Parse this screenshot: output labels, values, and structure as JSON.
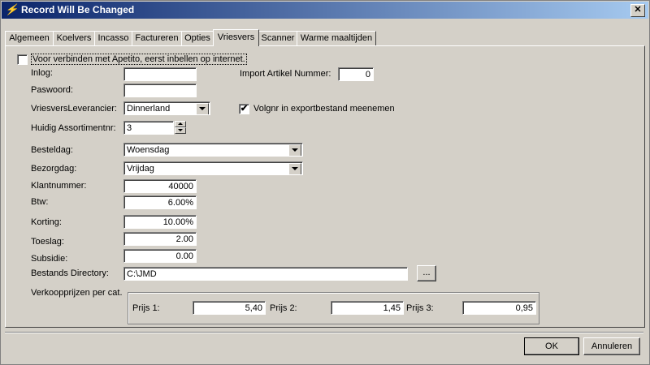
{
  "window": {
    "title": "Record Will Be Changed"
  },
  "tabs": [
    {
      "label": "Algemeen"
    },
    {
      "label": "Koelvers"
    },
    {
      "label": "Incasso"
    },
    {
      "label": "Factureren"
    },
    {
      "label": "Opties"
    },
    {
      "label": "Vriesvers",
      "active": true
    },
    {
      "label": "Scanner"
    },
    {
      "label": "Warme maaltijden"
    }
  ],
  "form": {
    "apetito_checkbox_label": "Voor verbinden met Apetito, eerst inbellen op internet.",
    "apetito_checked": false,
    "inlog_label": "Inlog:",
    "inlog_value": "",
    "paswoord_label": "Paswoord:",
    "paswoord_value": "",
    "import_label": "Import Artikel Nummer:",
    "import_value": "0",
    "leverancier_label": "VriesversLeverancier:",
    "leverancier_value": "Dinnerland",
    "volgnr_label": "Volgnr in exportbestand meenemen",
    "volgnr_checked": true,
    "assortiment_label": "Huidig Assortimentnr:",
    "assortiment_value": "3",
    "besteldag_label": "Besteldag:",
    "besteldag_value": "Woensdag",
    "bezorgdag_label": "Bezorgdag:",
    "bezorgdag_value": "Vrijdag",
    "klantnummer_label": "Klantnummer:",
    "klantnummer_value": "40000",
    "btw_label": "Btw:",
    "btw_value": "6.00%",
    "korting_label": "Korting:",
    "korting_value": "10.00%",
    "toeslag_label": "Toeslag:",
    "toeslag_value": "2.00",
    "subsidie_label": "Subsidie:",
    "subsidie_value": "0.00",
    "directory_label": "Bestands Directory:",
    "directory_value": "C:\\JMD",
    "browse_label": "...",
    "verkoop_label": "Verkoopprijzen per cat.",
    "prijs1_label": "Prijs 1:",
    "prijs1_value": "5,40",
    "prijs2_label": "Prijs 2:",
    "prijs2_value": "1,45",
    "prijs3_label": "Prijs 3:",
    "prijs3_value": "0,95"
  },
  "footer": {
    "ok_label": "OK",
    "cancel_label": "Annuleren"
  }
}
